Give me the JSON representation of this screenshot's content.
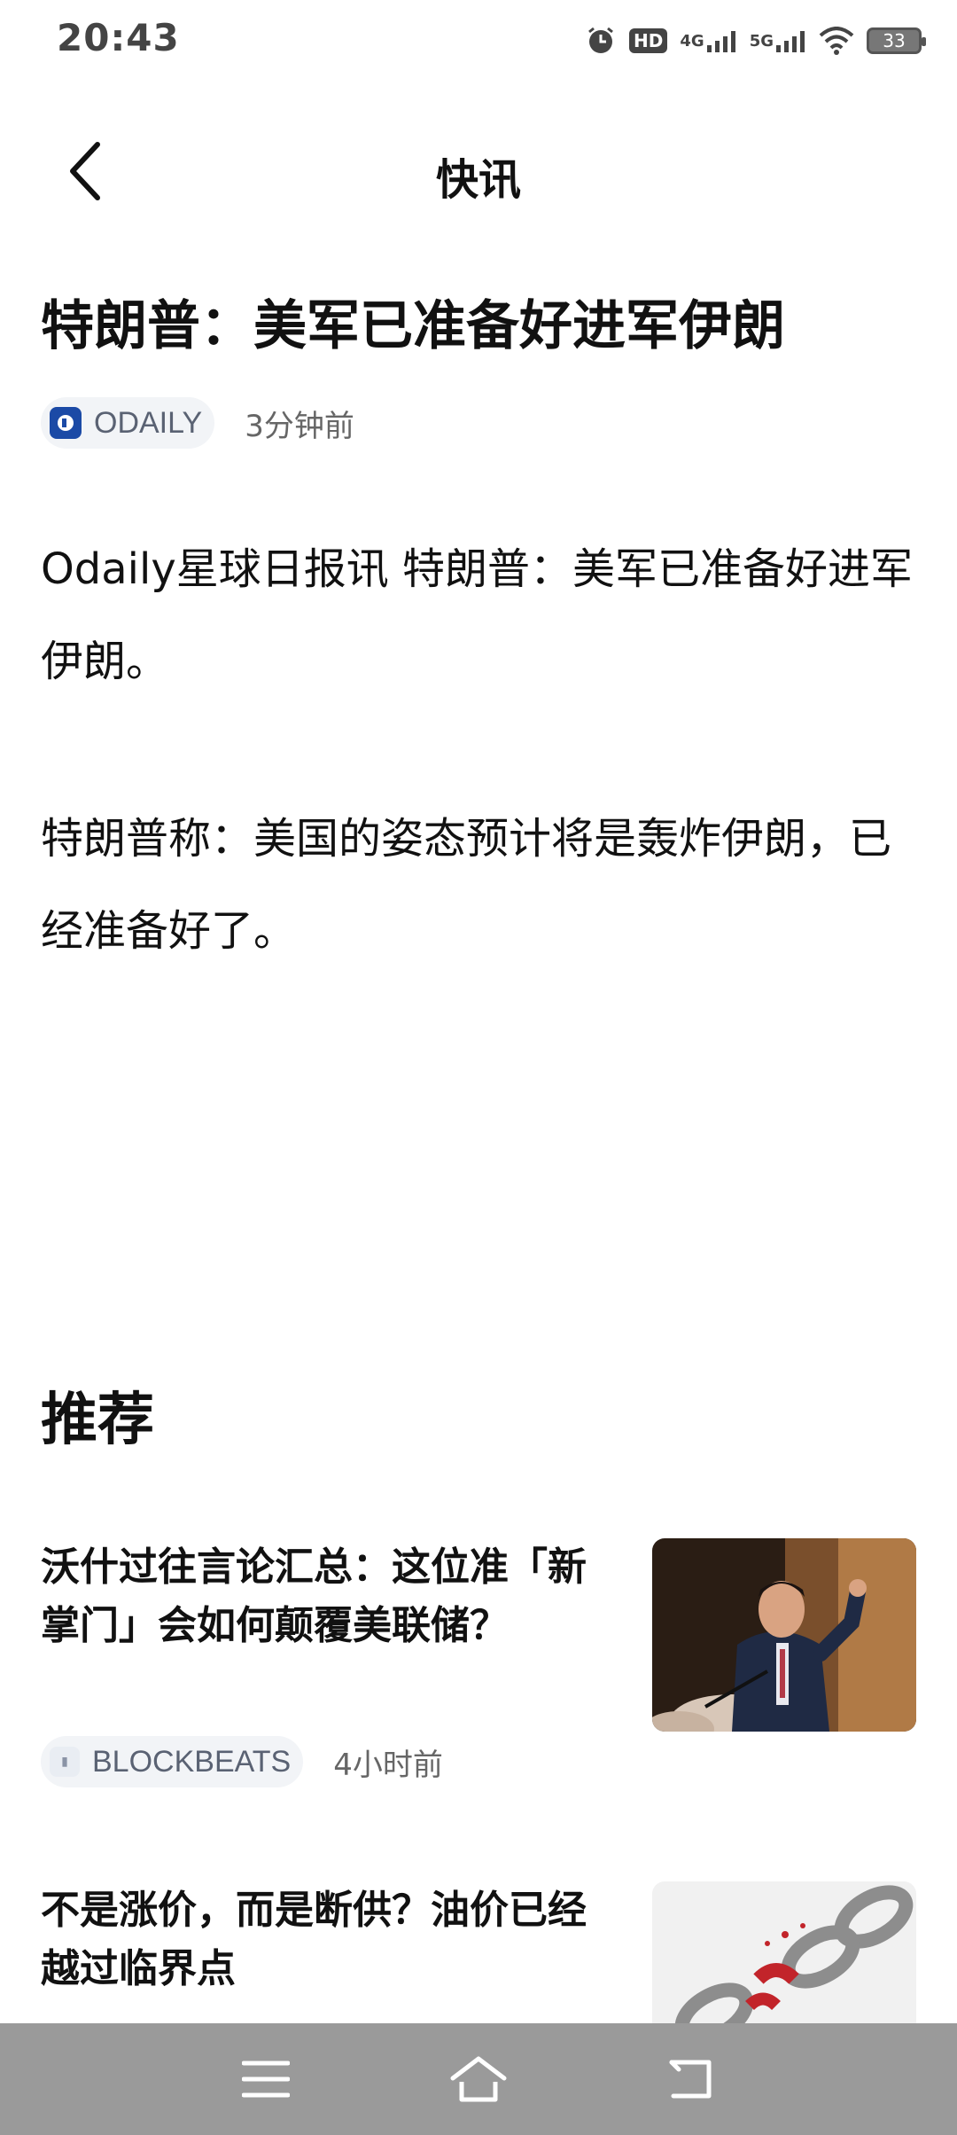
{
  "status_bar": {
    "time": "20:43",
    "battery": "33",
    "icons": [
      "alarm-icon",
      "hd-icon",
      "4g-signal-icon",
      "5g-signal-icon",
      "wifi-icon",
      "battery-icon"
    ],
    "hd_label": "HD",
    "net1": "4G",
    "net2": "5G"
  },
  "header": {
    "title": "快讯"
  },
  "article": {
    "title": "特朗普：美军已准备好进军伊朗",
    "source": "ODAILY",
    "time": "3分钟前",
    "paragraphs": [
      "Odaily星球日报讯 特朗普：美军已准备好进军伊朗。",
      "特朗普称：美国的姿态预计将是轰炸伊朗，已经准备好了。"
    ]
  },
  "recommend": {
    "heading": "推荐",
    "items": [
      {
        "title": "沃什过往言论汇总：这位准「新掌门」会如何颠覆美联储？",
        "source": "BLOCKBEATS",
        "time": "4小时前"
      },
      {
        "title": "不是涨价，而是断供？油价已经越过临界点",
        "source": "",
        "time": ""
      }
    ]
  },
  "colors": {
    "accent": "#1b4aa6",
    "nav_bar": "#9a9a9a",
    "chip_bg": "#f2f4f7"
  }
}
